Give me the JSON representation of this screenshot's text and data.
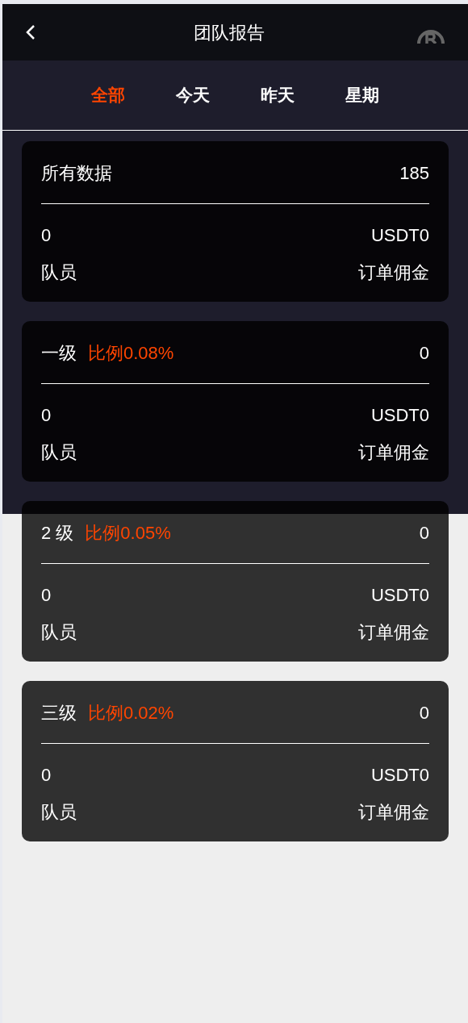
{
  "header": {
    "title": "团队报告"
  },
  "tabs": [
    {
      "label": "全部",
      "selected": true
    },
    {
      "label": "今天",
      "selected": false
    },
    {
      "label": "昨天",
      "selected": false
    },
    {
      "label": "星期",
      "selected": false
    }
  ],
  "cards": [
    {
      "title": "所有数据",
      "value": "185",
      "members": "0",
      "members_label": "队员",
      "commission": "USDT0",
      "commission_label": "订单佣金"
    },
    {
      "title": "一级",
      "ratio": "比例0.08%",
      "value": "0",
      "members": "0",
      "members_label": "队员",
      "commission": "USDT0",
      "commission_label": "订单佣金"
    },
    {
      "title": "2 级",
      "ratio": "比例0.05%",
      "value": "0",
      "members": "0",
      "members_label": "队员",
      "commission": "USDT0",
      "commission_label": "订单佣金"
    },
    {
      "title": "三级",
      "ratio": "比例0.02%",
      "value": "0",
      "members": "0",
      "members_label": "队员",
      "commission": "USDT0",
      "commission_label": "订单佣金"
    }
  ]
}
